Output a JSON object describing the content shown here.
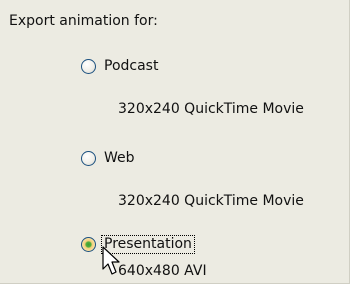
{
  "heading": "Export animation for:",
  "options": [
    {
      "label": "Podcast",
      "description": "320x240 QuickTime Movie",
      "checked": false
    },
    {
      "label": "Web",
      "description": "320x240 QuickTime Movie",
      "checked": false
    },
    {
      "label": "Presentation",
      "description": "640x480 AVI",
      "checked": true
    }
  ],
  "colors": {
    "panel_background": "#ecebe2",
    "radio_border": "#1c5180",
    "radio_selected_dot": "#3d9b2f",
    "radio_hover_ring": "#f3cf7a"
  },
  "icons": {
    "cursor": "arrow-pointer-icon"
  }
}
